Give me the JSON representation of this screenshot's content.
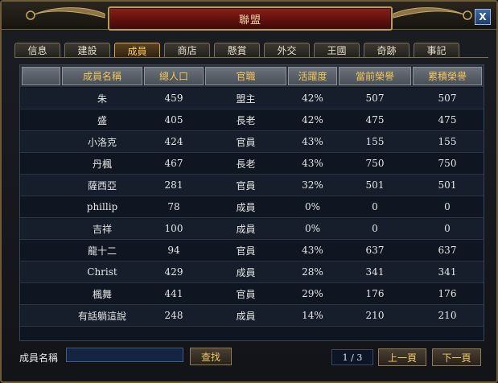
{
  "window": {
    "title": "聯盟",
    "close_label": "X"
  },
  "tabs": [
    {
      "label": "信息"
    },
    {
      "label": "建設"
    },
    {
      "label": "成員"
    },
    {
      "label": "商店"
    },
    {
      "label": "懸賞"
    },
    {
      "label": "外交"
    },
    {
      "label": "王國"
    },
    {
      "label": "奇跡"
    },
    {
      "label": "事記"
    }
  ],
  "active_tab": "成員",
  "table": {
    "headers": [
      "",
      "成員名稱",
      "總人口",
      "官職",
      "活躍度",
      "當前榮譽",
      "累積榮譽"
    ],
    "rows": [
      [
        "朱",
        "459",
        "盟主",
        "42%",
        "507",
        "507"
      ],
      [
        "盛",
        "405",
        "長老",
        "42%",
        "475",
        "475"
      ],
      [
        "小洛克",
        "424",
        "官員",
        "43%",
        "155",
        "155"
      ],
      [
        "丹楓",
        "467",
        "長老",
        "43%",
        "750",
        "750"
      ],
      [
        "薩西亞",
        "281",
        "官員",
        "32%",
        "501",
        "501"
      ],
      [
        "phillip",
        "78",
        "成員",
        "0%",
        "0",
        "0"
      ],
      [
        "吉祥",
        "100",
        "成員",
        "0%",
        "0",
        "0"
      ],
      [
        "龍十二",
        "94",
        "官員",
        "43%",
        "637",
        "637"
      ],
      [
        "Christ",
        "429",
        "成員",
        "28%",
        "341",
        "341"
      ],
      [
        "楓舞",
        "441",
        "官員",
        "29%",
        "176",
        "176"
      ],
      [
        "有話躺這說",
        "248",
        "成員",
        "14%",
        "210",
        "210"
      ]
    ]
  },
  "footer": {
    "search_label": "成員名稱",
    "search_value": "",
    "search_button": "查找",
    "page_indicator": "1 / 3",
    "prev_button": "上一頁",
    "next_button": "下一頁"
  },
  "colors": {
    "accent_gold": "#f3c65a",
    "title_red": "#8a1f1a",
    "frame_bronze": "#b99a5c"
  }
}
